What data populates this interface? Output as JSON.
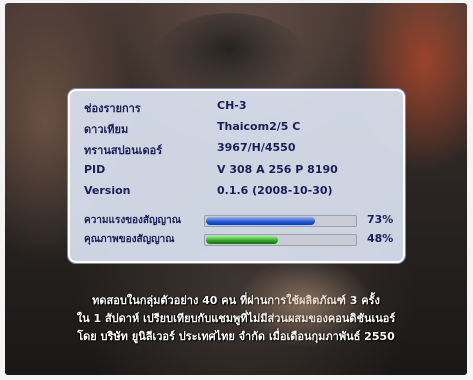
{
  "info": {
    "rows": [
      {
        "label": "ช่องรายการ",
        "value": "CH-3"
      },
      {
        "label": "ดาวเทียม",
        "value": "Thaicom2/5 C"
      },
      {
        "label": "ทรานสปอนเดอร์",
        "value": "3967/H/4550"
      },
      {
        "label": "PID",
        "value": "V 308  A 256  P 8190"
      },
      {
        "label": "Version",
        "value": "0.1.6  (2008-10-30)"
      }
    ],
    "signal_strength": {
      "label": "ความแรงของสัญญาณ",
      "value": 73,
      "display": "73%"
    },
    "signal_quality": {
      "label": "คุณภาพของสัญญาณ",
      "value": 48,
      "display": "48%"
    }
  },
  "ticker": {
    "line1": "ทดสอบในกลุ่มตัวอย่าง 40 คน ที่ผ่านการใช้ผลิตภัณฑ์ 3 ครั้ง",
    "line2": "ใน 1 สัปดาห์ เปรียบเทียบกับแชมพูที่ไม่มีส่วนผสมของคอนดิชันเนอร์",
    "line3": "โดย บริษัท ยูนิลีเวอร์ ประเทศไทย จำกัด เมื่อเดือนกุมภาพันธ์ 2550"
  },
  "colors": {
    "strength_bar": "#2257d8",
    "quality_bar": "#2fa226",
    "panel_text": "#1a1f5a"
  }
}
